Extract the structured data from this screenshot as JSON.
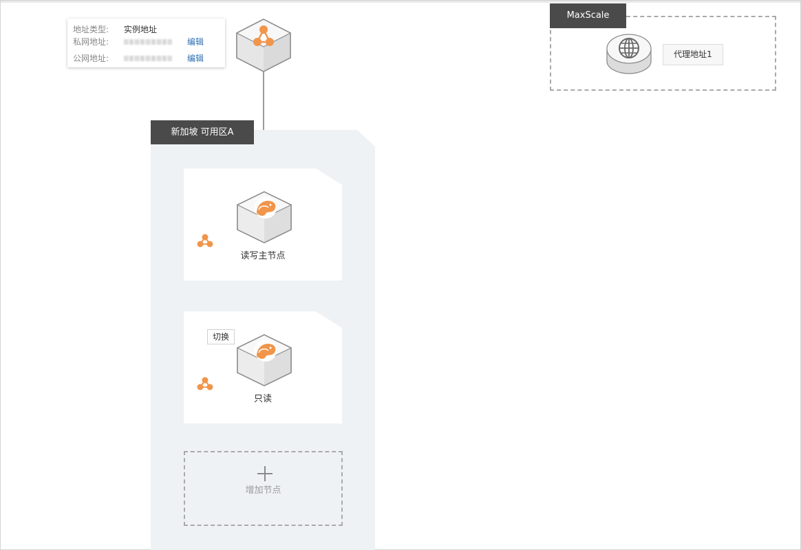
{
  "address_card": {
    "type_label": "地址类型:",
    "type_value": "实例地址",
    "private_label": "私网地址:",
    "public_label": "公网地址:",
    "edit_label": "编辑"
  },
  "zone": {
    "title": "新加坡 可用区A",
    "nodes": [
      {
        "label": "读写主节点"
      },
      {
        "label": "只读",
        "switch_label": "切换"
      }
    ],
    "add_node_label": "增加节点"
  },
  "maxscale": {
    "title": "MaxScale",
    "proxy_label": "代理地址1"
  },
  "colors": {
    "accent_orange": "#f0954a",
    "tag_dark": "#4a4a4a",
    "link_blue": "#2f6fb3",
    "zone_bg": "#eff2f5"
  }
}
